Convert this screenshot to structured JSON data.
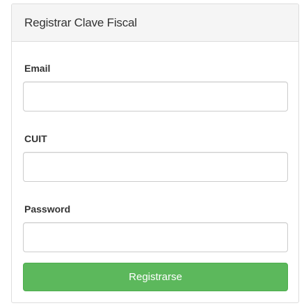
{
  "panel": {
    "title": "Registrar Clave Fiscal"
  },
  "form": {
    "fields": [
      {
        "label": "Email",
        "value": "",
        "placeholder": ""
      },
      {
        "label": "CUIT",
        "value": "",
        "placeholder": ""
      },
      {
        "label": "Password",
        "value": "",
        "placeholder": ""
      }
    ],
    "submit_label": "Registrarse"
  },
  "colors": {
    "submit_bg": "#5cb85c",
    "heading_bg": "#f5f5f5",
    "border": "#dddddd"
  }
}
